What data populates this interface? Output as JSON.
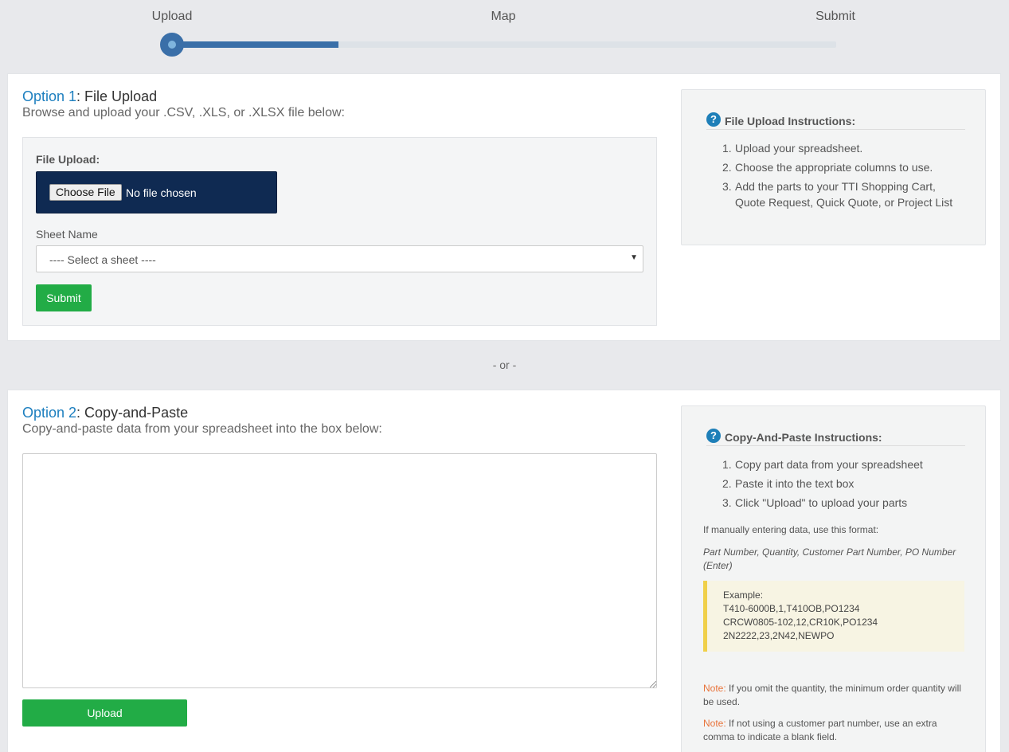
{
  "stepper": {
    "steps": [
      "Upload",
      "Map",
      "Submit"
    ],
    "current_step": 1,
    "progress_fraction": 0.25
  },
  "option1": {
    "prefix": "Option 1",
    "title": ": File Upload",
    "subtitle": "Browse and upload your .CSV, .XLS, or .XLSX file below:",
    "file_label": "File Upload:",
    "choose_label": "Choose File",
    "file_status": "No file chosen",
    "sheet_label": "Sheet Name",
    "sheet_selected": "---- Select a sheet ----",
    "submit_label": "Submit",
    "instructions": {
      "title": "File Upload Instructions:",
      "items": [
        "Upload your spreadsheet.",
        "Choose the appropriate columns to use.",
        "Add the parts to your TTI Shopping Cart, Quote Request, Quick Quote, or Project List"
      ]
    }
  },
  "separator": "- or -",
  "option2": {
    "prefix": "Option 2",
    "title": ": Copy-and-Paste",
    "subtitle": "Copy-and-paste data from your spreadsheet into the box below:",
    "paste_value": "",
    "upload_label": "Upload",
    "instructions": {
      "title": "Copy-And-Paste Instructions:",
      "items": [
        "Copy part data from your spreadsheet",
        "Paste it into the text box",
        "Click \"Upload\" to upload your parts"
      ],
      "format_intro": "If manually entering data, use this format:",
      "format_line": "Part Number, Quantity, Customer Part Number, PO Number (Enter)",
      "example_heading": "Example:",
      "example_lines": [
        "T410-6000B,1,T410OB,PO1234",
        "CRCW0805-102,12,CR10K,PO1234",
        "2N2222,23,2N42,NEWPO"
      ],
      "note_label": "Note:",
      "note1": " If you omit the quantity, the minimum order quantity will be used.",
      "note2": " If not using a customer part number, use an extra comma to indicate a blank field."
    }
  },
  "colors": {
    "accent_blue": "#1d7fbf",
    "progress_blue": "#3a6fa8",
    "button_green": "#22ac46",
    "file_input_bg": "#0f2a52",
    "note_orange": "#e8733a",
    "example_bar": "#f0d04a"
  },
  "icons": [
    "question-circle-icon",
    "chevron-down-icon"
  ]
}
